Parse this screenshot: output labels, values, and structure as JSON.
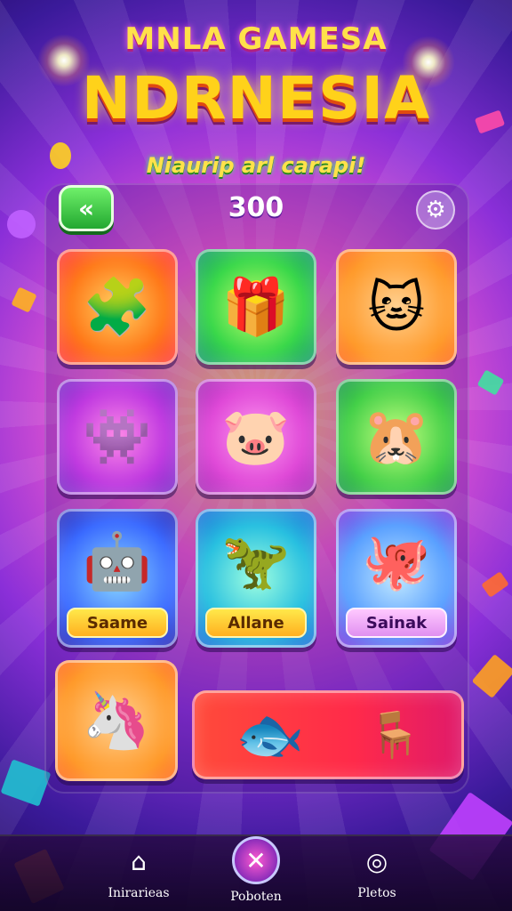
{
  "header": {
    "title_top": "MNLA GAMESA",
    "title_main": "NDRNESIA",
    "subtitle": "Niaurip arl carapi!"
  },
  "hud": {
    "score": "300",
    "back_icon": "double-chevron-left-icon",
    "settings_icon": "gear-icon"
  },
  "tiles": [
    {
      "icon": "🧩",
      "color": "#ff7a1a"
    },
    {
      "icon": "🎁",
      "color": "#3ad84a"
    },
    {
      "icon": "🐱",
      "color": "#ff9a2a"
    },
    {
      "icon": "👾",
      "color": "#c03ae0"
    },
    {
      "icon": "🐷",
      "color": "#e04ad8"
    },
    {
      "icon": "🐹",
      "color": "#44d048"
    },
    {
      "icon": "🤖",
      "color": "#3a6aff",
      "label": "Saame"
    },
    {
      "icon": "🦖",
      "color": "#28c0e0",
      "label": "Allane"
    },
    {
      "icon": "🐙",
      "color": "#5aa0ff",
      "label": "Sainak"
    },
    {
      "icon": "🦄",
      "color": "#ff9a2a"
    },
    {
      "icon": "🐟",
      "icon2": "🪑",
      "color": "#ff2a4a"
    }
  ],
  "nav": {
    "items": [
      {
        "icon": "⌂",
        "label": "Inirarieas"
      },
      {
        "icon": "✕",
        "label": "Poboten"
      },
      {
        "icon": "◎",
        "label": "Pletos"
      }
    ]
  }
}
